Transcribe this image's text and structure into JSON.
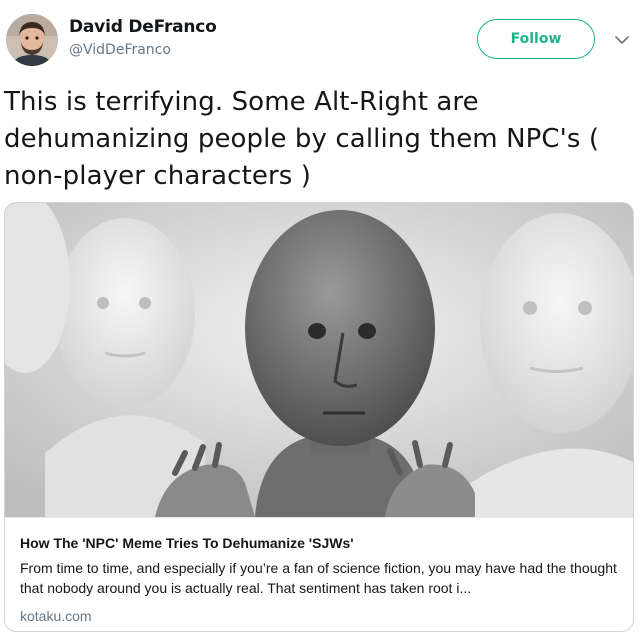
{
  "tweet": {
    "author": {
      "display_name": "David DeFranco",
      "handle": "@VidDeFranco"
    },
    "follow_label": "Follow",
    "text": "This is terrifying. Some Alt-Right are\ndehumanizing people by calling them NPC's (\nnon-player characters )"
  },
  "card": {
    "title": "How The 'NPC' Meme Tries To Dehumanize 'SJWs'",
    "description": "From time to time, and especially if you’re a fan of science fiction, you may have had the thought that nobody around you is actually real. That sentiment has taken root i...",
    "domain": "kotaku.com"
  },
  "colors": {
    "follow_accent": "#1cb48c",
    "text": "#14171a",
    "secondary": "#657786",
    "border": "#ccd6dd"
  },
  "icons": {
    "caret": "chevron-down-icon",
    "avatar": "avatar"
  }
}
